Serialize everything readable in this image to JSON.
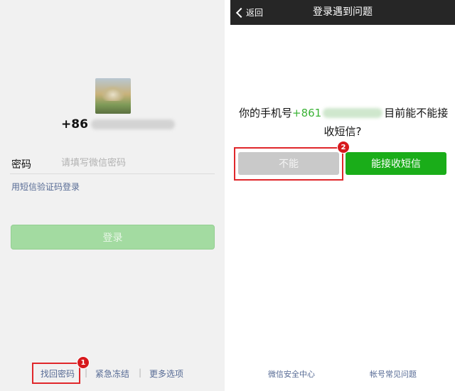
{
  "left_screen": {
    "phone_prefix": "+86",
    "password_label": "密码",
    "password_placeholder": "请填写微信密码",
    "sms_login_link": "用短信验证码登录",
    "login_button": "登录",
    "bottom_links": {
      "recover_password": "找回密码",
      "separator": "|",
      "emergency_freeze": "紧急冻结",
      "more_options": "更多选项"
    },
    "step_badge": "1"
  },
  "right_screen": {
    "back_label": "返回",
    "title": "登录遇到问题",
    "question": {
      "part1": "你的手机号",
      "phone_prefix": "+861",
      "part2": "目前能不能接",
      "line2": "收短信?"
    },
    "no_button": "不能",
    "yes_button": "能接收短信",
    "step_badge": "2",
    "footer_links": {
      "security_center": "微信安全中心",
      "faq": "帐号常见问题"
    }
  },
  "colors": {
    "wechat_green": "#1aad19",
    "disabled_green": "#a3dba1",
    "link_blue": "#576b95",
    "highlight_red": "#e0272b",
    "navbar_dark": "#262626"
  },
  "icons": {
    "back": "chevron-left-icon"
  }
}
